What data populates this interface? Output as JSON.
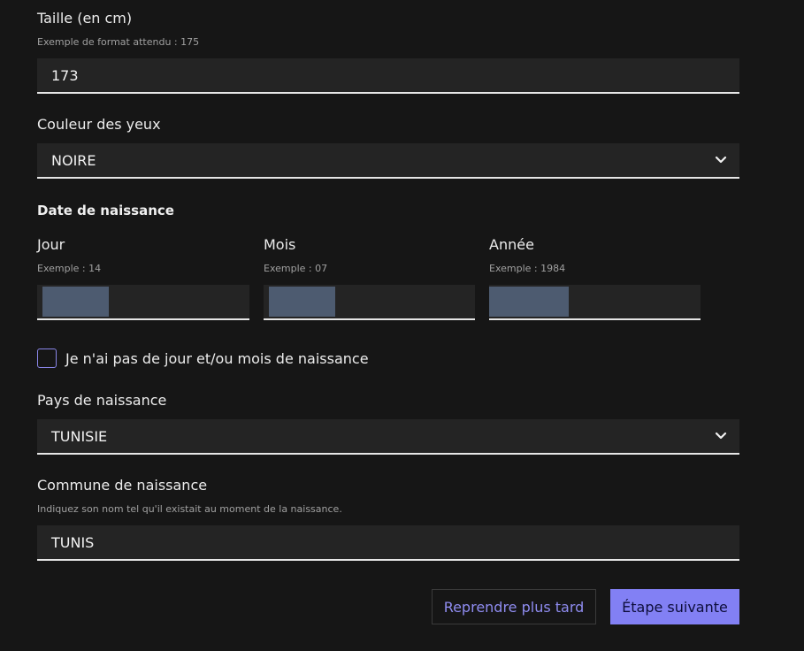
{
  "height": {
    "label": "Taille (en cm)",
    "hint": "Exemple de format attendu : 175",
    "value": "173"
  },
  "eye_color": {
    "label": "Couleur des yeux",
    "selected": "NOIRE",
    "icon": "chevron-down-icon"
  },
  "birth_date": {
    "title": "Date de naissance",
    "day": {
      "label": "Jour",
      "hint": "Exemple : 14"
    },
    "month": {
      "label": "Mois",
      "hint": "Exemple : 07"
    },
    "year": {
      "label": "Année",
      "hint": "Exemple : 1984"
    },
    "no_day_month_checkbox": {
      "label": "Je n'ai pas de jour et/ou mois de naissance",
      "checked": false
    }
  },
  "birth_country": {
    "label": "Pays de naissance",
    "selected": "TUNISIE",
    "icon": "chevron-down-icon"
  },
  "birth_city": {
    "label": "Commune de naissance",
    "hint": "Indiquez son nom tel qu'il existait au moment de la naissance.",
    "value": "TUNIS"
  },
  "actions": {
    "later_label": "Reprendre plus tard",
    "next_label": "Étape suivante"
  },
  "colors": {
    "background": "#161616",
    "field_bg": "#242424",
    "accent": "#8280f4",
    "redacted_block": "#4d5b70"
  }
}
